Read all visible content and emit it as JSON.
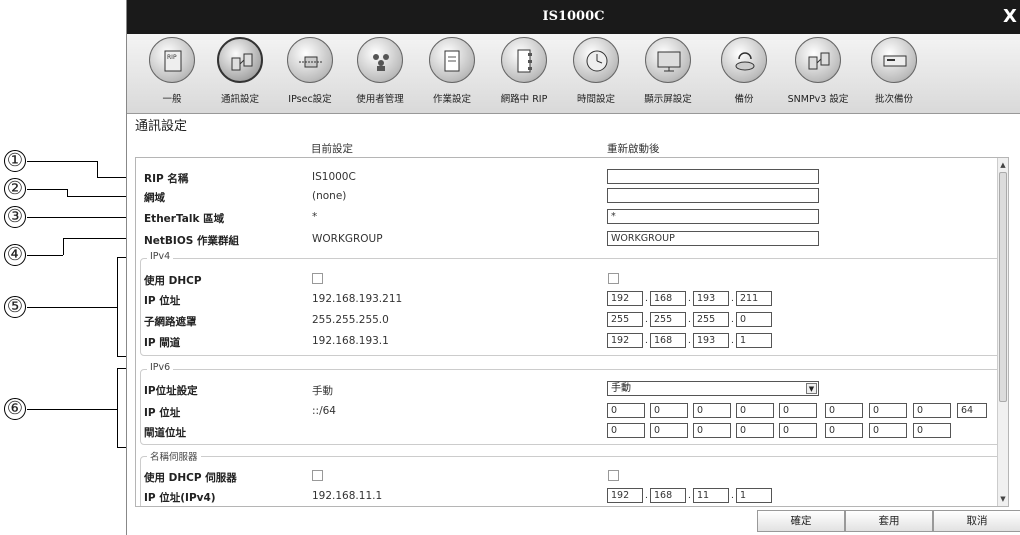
{
  "window": {
    "title": "IS1000C",
    "close_glyph": "X"
  },
  "toolbar": [
    {
      "label": "一般",
      "icon": "rip-server-icon"
    },
    {
      "label": "通訊設定",
      "icon": "network-icon"
    },
    {
      "label": "IPsec設定",
      "icon": "ipsec-icon"
    },
    {
      "label": "使用者管理",
      "icon": "users-icon"
    },
    {
      "label": "作業設定",
      "icon": "job-icon"
    },
    {
      "label": "網路中 RIP",
      "icon": "network-rip-icon"
    },
    {
      "label": "時間設定",
      "icon": "clock-icon"
    },
    {
      "label": "顯示屏設定",
      "icon": "display-icon"
    },
    {
      "label": "備份",
      "icon": "backup-icon"
    },
    {
      "label": "SNMPv3 設定",
      "icon": "snmp-icon"
    },
    {
      "label": "批次備份",
      "icon": "batch-backup-icon"
    }
  ],
  "section_title": "通訊設定",
  "columns": {
    "current": "目前設定",
    "after_restart": "重新啟動後"
  },
  "rows": {
    "rip_name": {
      "label": "RIP 名稱",
      "current": "IS1000C",
      "value": ""
    },
    "domain": {
      "label": "網域",
      "current": "(none)",
      "value": ""
    },
    "ethertalk": {
      "label": "EtherTalk 區域",
      "current": "*",
      "value": "*"
    },
    "netbios": {
      "label": "NetBIOS 作業群組",
      "current": "WORKGROUP",
      "value": "WORKGROUP"
    }
  },
  "ipv4": {
    "title": "IPv4",
    "dhcp_label": "使用 DHCP",
    "ip_label": "IP 位址",
    "ip_current": "192.168.193.211",
    "ip": [
      "192",
      "168",
      "193",
      "211"
    ],
    "mask_label": "子網路遮罩",
    "mask_current": "255.255.255.0",
    "mask": [
      "255",
      "255",
      "255",
      "0"
    ],
    "gw_label": "IP 閘道",
    "gw_current": "192.168.193.1",
    "gw": [
      "192",
      "168",
      "193",
      "1"
    ]
  },
  "ipv6": {
    "title": "IPv6",
    "setting_label": "IP位址設定",
    "setting_current": "手動",
    "setting_value": "手動",
    "ip_label": "IP 位址",
    "ip_current": "::/64",
    "ip": [
      "0",
      "0",
      "0",
      "0",
      "0",
      "0",
      "0",
      "0",
      "64"
    ],
    "gw_label": "閘道位址",
    "gw": [
      "0",
      "0",
      "0",
      "0",
      "0",
      "0",
      "0",
      "0"
    ]
  },
  "dns": {
    "title": "名稱伺服器",
    "dhcp_label": "使用 DHCP 伺服器",
    "ip_label": "IP 位址(IPv4)",
    "ip_current": "192.168.11.1",
    "ip": [
      "192",
      "168",
      "11",
      "1"
    ]
  },
  "buttons": {
    "ok": "確定",
    "apply": "套用",
    "cancel": "取消"
  },
  "callouts": [
    "①",
    "②",
    "③",
    "④",
    "⑤",
    "⑥"
  ]
}
